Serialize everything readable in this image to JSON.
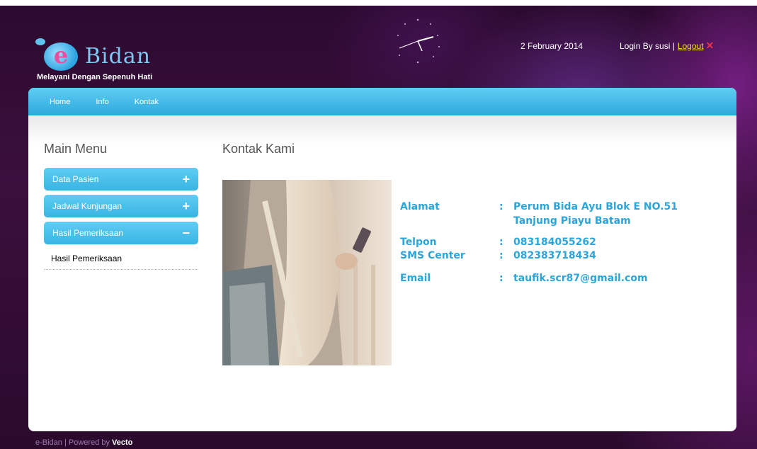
{
  "header": {
    "logo_letter": "e",
    "logo_word": "Bidan",
    "tagline": "Melayani Dengan Sepenuh Hati",
    "date": "2 February 2014",
    "login_text": "Login By susi |",
    "logout_label": "Logout"
  },
  "nav": {
    "items": [
      {
        "label": "Home"
      },
      {
        "label": "Info"
      },
      {
        "label": "Kontak"
      }
    ]
  },
  "sidebar": {
    "title": "Main Menu",
    "menus": [
      {
        "label": "Data Pasien",
        "sign": "+"
      },
      {
        "label": "Jadwal Kunjungan",
        "sign": "+"
      },
      {
        "label": "Hasil Pemeriksaan",
        "sign": "−"
      }
    ],
    "submenu": [
      {
        "label": "Hasil Pemeriksaan"
      }
    ]
  },
  "content": {
    "title": "Kontak Kami",
    "contact": {
      "alamat_label": "Alamat",
      "alamat_line1": "Perum Bida Ayu Blok E  NO.51",
      "alamat_line2": "Tanjung Piayu Batam",
      "telpon_label": "Telpon",
      "telpon_value": "083184055262",
      "sms_label": "SMS Center",
      "sms_value": "082383718434",
      "email_label": "Email",
      "email_value": "taufik.scr87@gmail.com",
      "colon": ":"
    }
  },
  "footer": {
    "text": "e-Bidan | Powered by",
    "brand": "Vecto"
  },
  "colors": {
    "accent": "#2ea8dc",
    "background": "#2a0a2c",
    "logout": "#f0e020"
  }
}
